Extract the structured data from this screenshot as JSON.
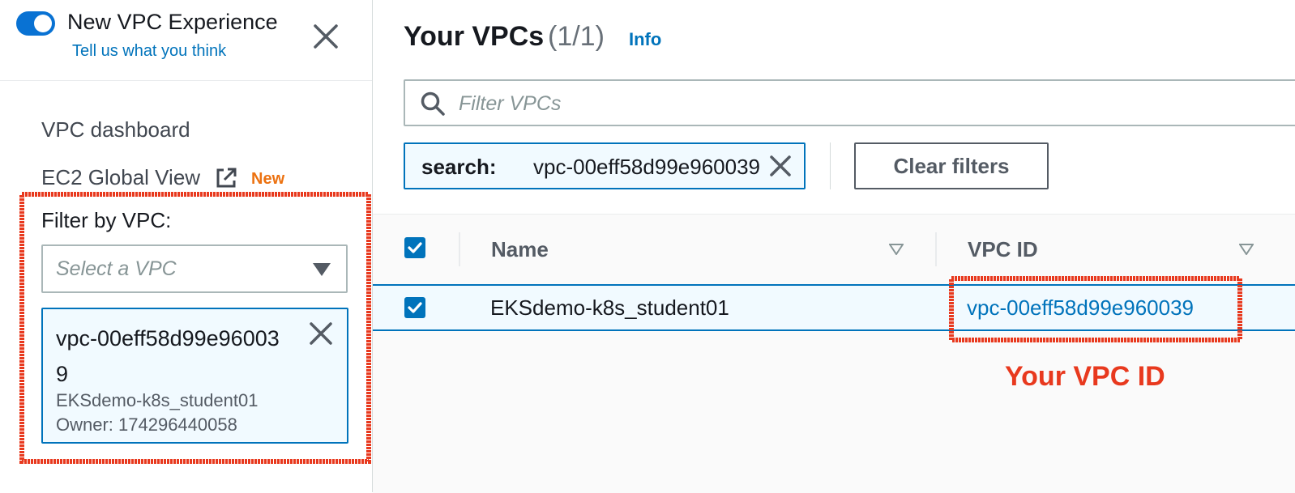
{
  "sidebar": {
    "experience_title": "New VPC Experience",
    "experience_link": "Tell us what you think",
    "nav_dashboard": "VPC dashboard",
    "nav_ec2_global": "EC2 Global View",
    "new_badge": "New",
    "filter_label": "Filter by VPC:",
    "select_placeholder": "Select a VPC",
    "selected_vpc": {
      "id": "vpc-00eff58d99e960039",
      "name": "EKSdemo-k8s_student01",
      "owner": "Owner: 174296440058"
    }
  },
  "main": {
    "title": "Your VPCs",
    "count": "(1/1)",
    "info_link": "Info",
    "search_placeholder": "Filter VPCs",
    "filter_token": {
      "key": "search:",
      "value": "vpc-00eff58d99e960039"
    },
    "clear_filters": "Clear filters",
    "table": {
      "columns": [
        "Name",
        "VPC ID"
      ],
      "rows": [
        {
          "name": "EKSdemo-k8s_student01",
          "vpc_id": "vpc-00eff58d99e960039",
          "selected": true
        }
      ]
    }
  },
  "annotation": {
    "label": "Your VPC ID",
    "color": "#e8391e"
  },
  "colors": {
    "accent": "#0073bb",
    "badge": "#ec7211",
    "selected_bg": "#f1faff"
  }
}
